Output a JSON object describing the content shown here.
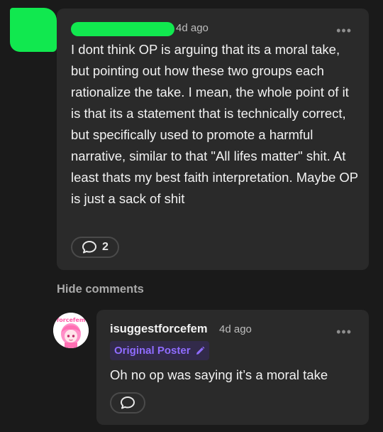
{
  "comment": {
    "time": "4d ago",
    "text": "I dont think OP is arguing that its a moral take, but pointing out how these two groups each rationalize the take. I mean, the whole point of it is that its a statement that is technically correct, but specifically used to promote a harmful narrative, similar to that \"All lifes matter\" shit. At least thats my best faith interpretation. Maybe OP is just a sack of shit",
    "reply_count": "2",
    "more_icon": "more-horizontal-icon",
    "reply_icon": "speech-bubble-icon"
  },
  "hide_comments_label": "Hide comments",
  "reply": {
    "username": "isuggestforcefem",
    "time": "4d ago",
    "badge": "Original Poster",
    "badge_icon": "pencil-icon",
    "avatar_label": "forcefem",
    "text": "Oh no op was saying it’s a moral take",
    "more_icon": "more-horizontal-icon",
    "reply_icon": "speech-bubble-icon"
  },
  "colors": {
    "background": "#1a1a1a",
    "card": "#2a2a2a",
    "redaction": "#11e84f",
    "badge_text": "#8f6cff",
    "badge_bg": "#322a4a"
  }
}
